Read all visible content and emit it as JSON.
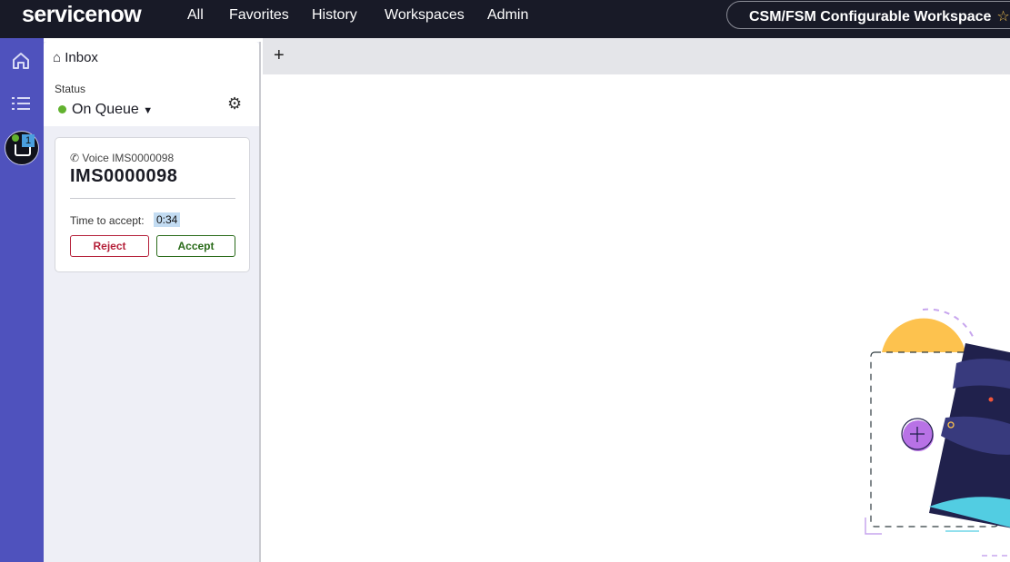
{
  "header": {
    "logo": "servicenow",
    "nav": [
      "All",
      "Favorites",
      "History",
      "Workspaces",
      "Admin"
    ],
    "workspace": "CSM/FSM Configurable Workspace"
  },
  "rail": {
    "inbox_badge": "1"
  },
  "inbox": {
    "title": "Inbox",
    "status_label": "Status",
    "status_value": "On Queue",
    "card": {
      "type": "Voice IMS0000098",
      "number": "IMS0000098",
      "time_label": "Time to accept:",
      "time_value": "0:34",
      "reject": "Reject",
      "accept": "Accept"
    }
  },
  "colors": {
    "header": "#181a27",
    "rail": "#4f52bd",
    "status_green": "#62b22f",
    "reject": "#b5213a",
    "accept": "#2a6b1a"
  }
}
